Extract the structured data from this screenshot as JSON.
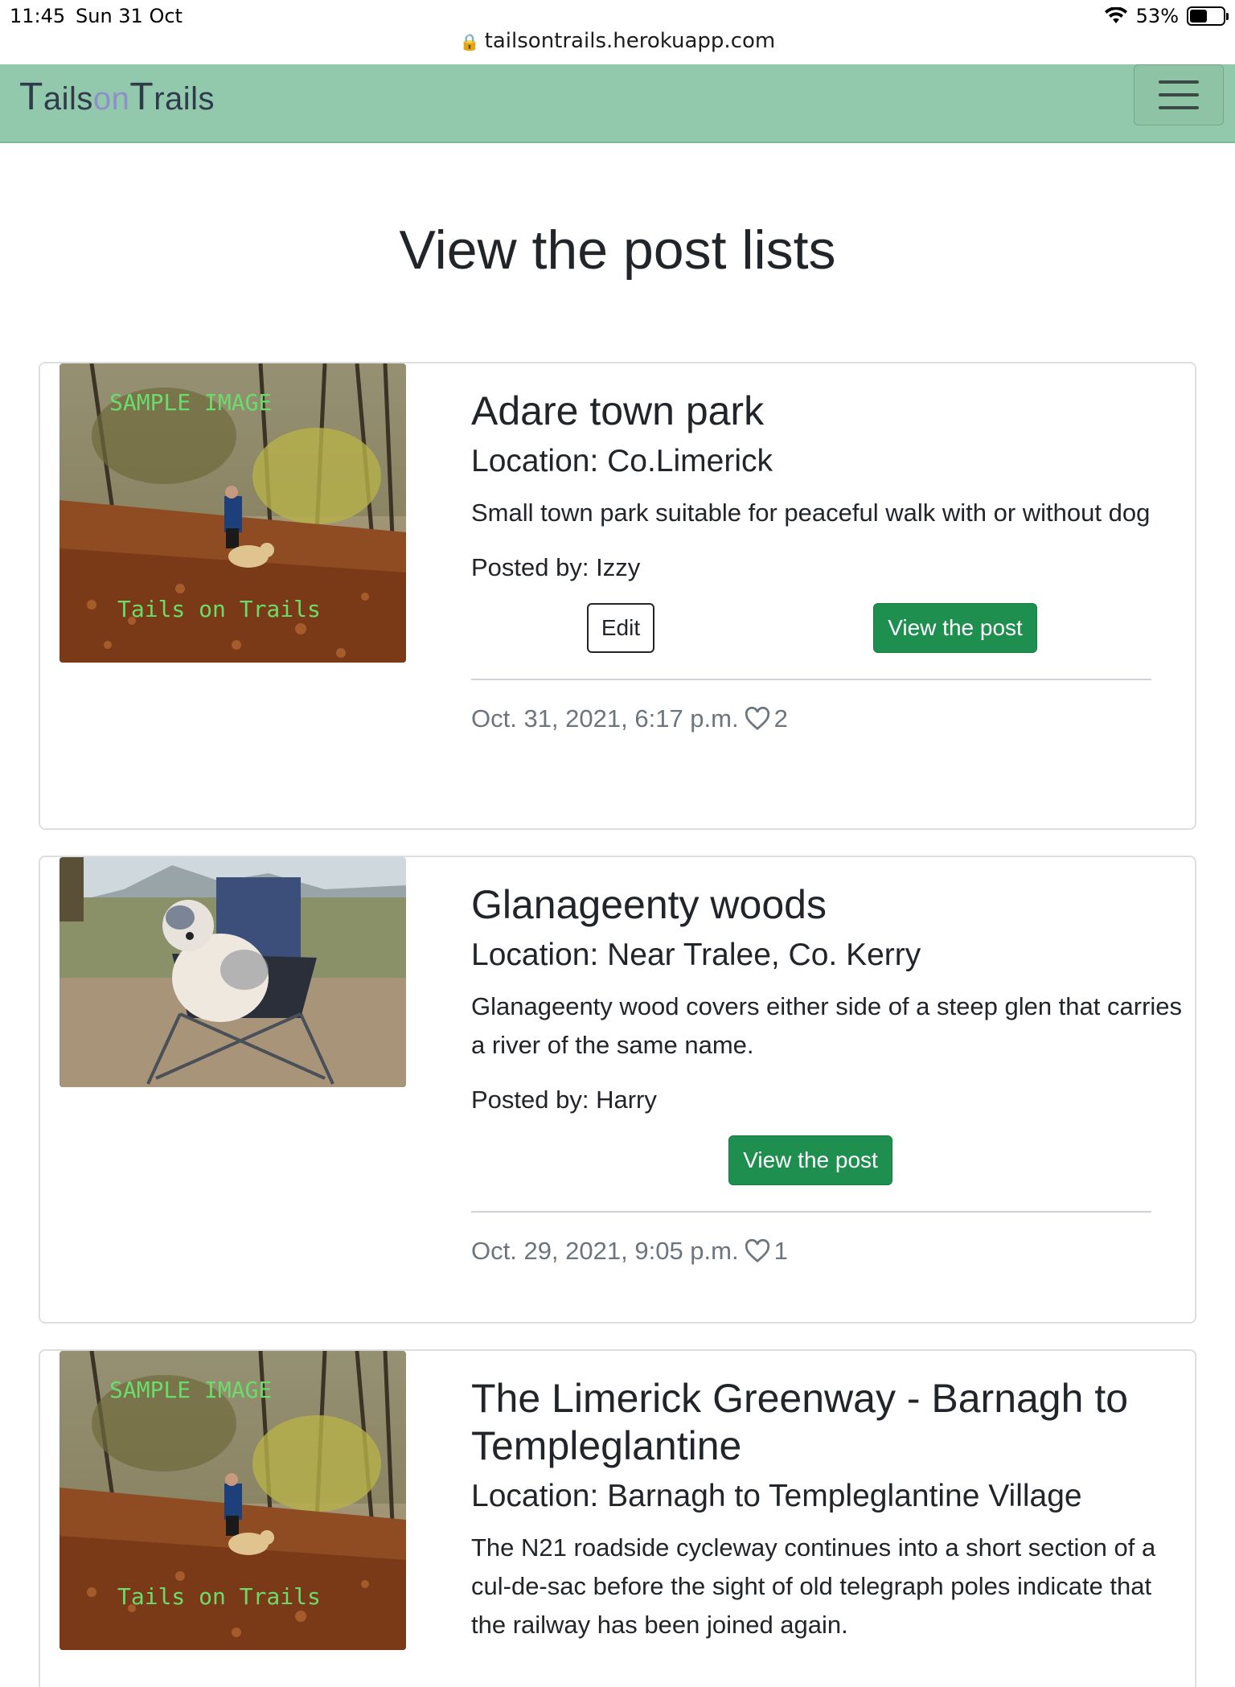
{
  "status": {
    "time": "11:45",
    "date": "Sun 31 Oct",
    "url": "tailsontrails.herokuapp.com",
    "battery": "53%",
    "battery_level": 0.53
  },
  "navbar": {
    "brand_t1": "T",
    "brand_ails": "ails",
    "brand_on": "on",
    "brand_t2": "T",
    "brand_rails": "rails"
  },
  "page": {
    "title": "View the post lists"
  },
  "posts": [
    {
      "title": "Adare town park",
      "location": "Location: Co.Limerick",
      "description": "Small town park suitable for peaceful walk with or without dog",
      "posted_by": "Posted by: Izzy",
      "edit_label": "Edit",
      "view_label": "View the post",
      "date": "Oct. 31, 2021, 6:17 p.m.",
      "likes": "2",
      "image_watermark_top": "SAMPLE  IMAGE",
      "image_watermark_bottom": "Tails  on  Trails"
    },
    {
      "title": "Glanageenty woods",
      "location": "Location: Near Tralee, Co. Kerry",
      "description": "Glanageenty wood covers either side of a steep glen that carries a river of the same name.",
      "posted_by": "Posted by: Harry",
      "view_label": "View the post",
      "date": "Oct. 29, 2021, 9:05 p.m.",
      "likes": "1"
    },
    {
      "title": "The Limerick Greenway - Barnagh to Templeglantine",
      "location": "Location: Barnagh to Templeglantine Village",
      "description": "The N21 roadside cycleway continues into a short section of a cul-de-sac before the sight of old telegraph poles indicate that the railway has been joined again.",
      "image_watermark_top": "SAMPLE  IMAGE",
      "image_watermark_bottom": "Tails  on  Trails"
    }
  ]
}
